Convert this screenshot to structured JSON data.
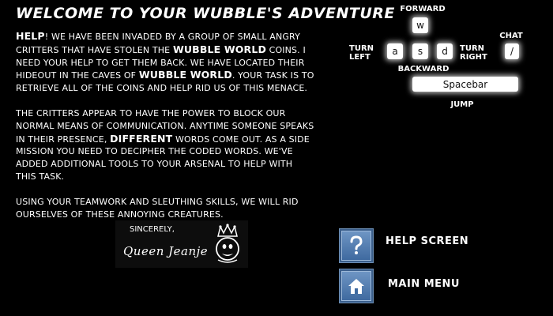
{
  "title": "Welcome to your Wubble's Adventure",
  "paragraph1": {
    "p1": "Help",
    "p2": "! We have been invaded by a group of small angry critters that have stolen the ",
    "p3": "Wubble World",
    "p4": " coins.  I need your help to get them back.  We have located their hideout in the caves of ",
    "p5": "Wubble World",
    "p6": ".  Your task is to retrieve all of the coins and help rid us of this menace."
  },
  "paragraph2": {
    "p1": "The critters appear to have the power to block our normal means of communication.  Anytime someone speaks in their presence, ",
    "p2": "different",
    "p3": " words come out.  As a side mission you need to decipher the coded words.  We've added additional tools to your arsenal to help with this task."
  },
  "paragraph3": "Using your teamwork and sleuthing skills, we will rid ourselves of these annoying creatures.",
  "controls": {
    "forward_label": "Forward",
    "forward_key": "w",
    "turn_left_label_1": "Turn",
    "turn_left_label_2": "Left",
    "left_key": "a",
    "backward_key": "s",
    "right_key": "d",
    "turn_right_label_1": "Turn",
    "turn_right_label_2": "Right",
    "backward_label": "Backward",
    "chat_label": "Chat",
    "chat_key": "/",
    "jump_key": "Spacebar",
    "jump_label": "Jump"
  },
  "signature": {
    "sincerely": "Sincerely,",
    "name": "Queen Jeanje"
  },
  "menu": {
    "help_label": "Help Screen",
    "help_icon": "question-mark-icon",
    "main_label": "Main Menu",
    "main_icon": "house-icon"
  },
  "colors": {
    "background": "#000000",
    "text": "#ffffff",
    "button_blue": "#3f6aa0"
  }
}
